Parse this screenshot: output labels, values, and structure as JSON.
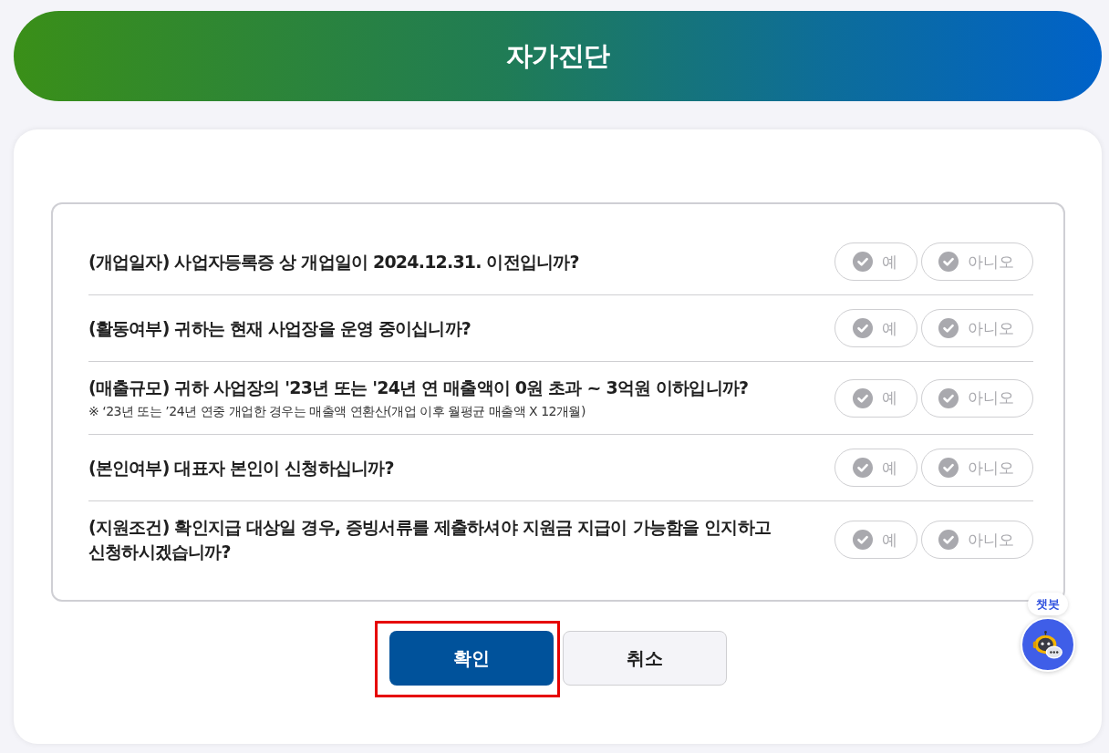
{
  "header": {
    "title": "자가진단"
  },
  "questions": [
    {
      "lines": [
        "(개업일자) 사업자등록증 상 개업일이 2024.12.31. 이전입니까?"
      ],
      "options": [
        {
          "label": "예",
          "selected": false
        },
        {
          "label": "아니오",
          "selected": false
        }
      ]
    },
    {
      "lines": [
        "(활동여부) 귀하는 현재 사업장을 운영 중이십니까?"
      ],
      "options": [
        {
          "label": "예",
          "selected": false
        },
        {
          "label": "아니오",
          "selected": false
        }
      ]
    },
    {
      "lines": [
        "(매출규모) 귀하 사업장의 '23년 또는 '24년 연 매출액이 0원 초과 ~ 3억원 이하입니까?"
      ],
      "note": "※ ‘23년 또는 ’24년 연중 개업한 경우는 매출액 연환산(개업 이후 월평균 매출액 X 12개월)",
      "options": [
        {
          "label": "예",
          "selected": false
        },
        {
          "label": "아니오",
          "selected": false
        }
      ]
    },
    {
      "lines": [
        "(본인여부) 대표자 본인이 신청하십니까?"
      ],
      "options": [
        {
          "label": "예",
          "selected": false
        },
        {
          "label": "아니오",
          "selected": false
        }
      ]
    },
    {
      "lines": [
        "(지원조건) 확인지급 대상일 경우, 증빙서류를 제출하셔야 지원금 지급이 가능함을 인지하고",
        "신청하시겠습니까?"
      ],
      "options": [
        {
          "label": "예",
          "selected": false
        },
        {
          "label": "아니오",
          "selected": false
        }
      ]
    }
  ],
  "buttons": [
    {
      "label": "확인",
      "kind": "primary",
      "highlighted": true
    },
    {
      "label": "취소",
      "kind": "secondary",
      "highlighted": false
    }
  ],
  "chatbot": {
    "label": "챗봇"
  }
}
